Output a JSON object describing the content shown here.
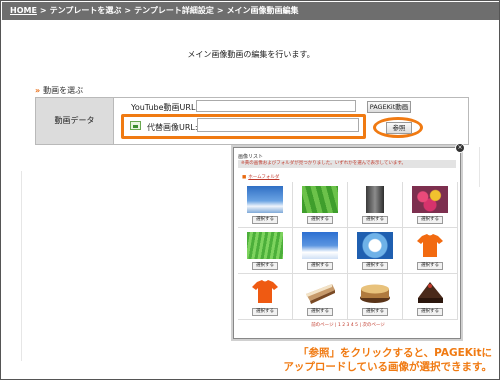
{
  "breadcrumb": {
    "items": [
      "HOME",
      "テンプレートを選ぶ",
      "テンプレート詳細設定",
      "メイン画像動画編集"
    ],
    "separator": ">"
  },
  "page_message": "メイン画像動画の編集を行います。",
  "section": {
    "heading": "動画を選ぶ",
    "row_label": "動画データ",
    "youtube_label": "YouTube動画URL:",
    "youtube_value": "",
    "pagekit_button": "PAGEKit動画",
    "alt_image_label": "代替画像URL:",
    "alt_image_value": "",
    "browse_button": "参照"
  },
  "popup": {
    "title": "画像リスト",
    "notice": "※黄の画像およびフォルダが見つかりました。いずれかを選んで表示しています。",
    "folder_link": "ホームフォルダ",
    "select_label": "選択する",
    "pager": "前のページ | 1 2 3 4 5 | 次のページ",
    "thumbnails": [
      "sky-clouds",
      "green-field",
      "city-building",
      "flowers",
      "grass",
      "blue-sky",
      "water-splash",
      "orange-shirt",
      "orange-shirt",
      "cake-slice",
      "cake",
      "chocolate-cake"
    ]
  },
  "caption": {
    "line1": "「参照」をクリックすると、PAGEKitに",
    "line2": "アップロードしている画像が選択できます。"
  },
  "colors": {
    "accent": "#f07a12",
    "breadcrumb_bg": "#6e6e6e",
    "label_bg": "#dcdcdc",
    "notice_text": "#c0392b"
  }
}
